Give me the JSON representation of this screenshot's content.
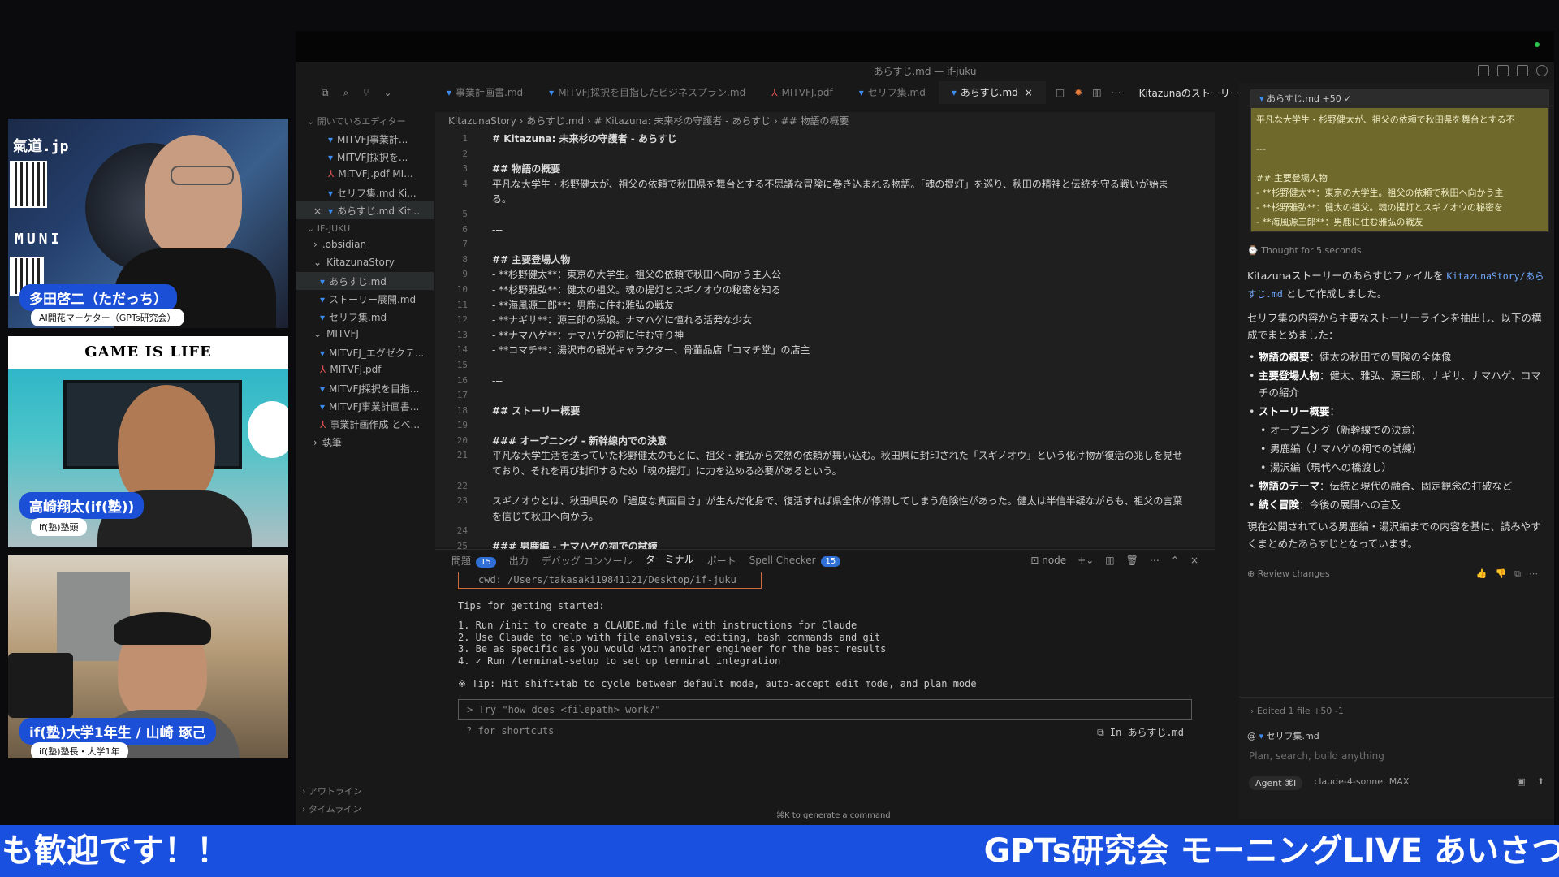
{
  "window": {
    "title": "あらすじ.md — if-juku"
  },
  "tabs": [
    {
      "label": "事業計画書.md",
      "kind": "md"
    },
    {
      "label": "MITVFJ採択を目指したビジネスプラン.md",
      "kind": "md"
    },
    {
      "label": "MITVFJ.pdf",
      "kind": "pdf"
    },
    {
      "label": "セリフ集.md",
      "kind": "md"
    },
    {
      "label": "あらすじ.md",
      "kind": "md",
      "active": true
    }
  ],
  "chat_tab": "Kitazunaのストーリーあらすじファイル作",
  "sidebar": {
    "open_editors_head": "開いているエディター",
    "open_editors": [
      {
        "label": "MITVFJ事業計...",
        "kind": "md"
      },
      {
        "label": "MITVFJ採択を...",
        "kind": "md"
      },
      {
        "label": "MITVFJ.pdf  MI...",
        "kind": "pdf"
      },
      {
        "label": "セリフ集.md  Ki...",
        "kind": "md"
      },
      {
        "label": "あらすじ.md  Kit...",
        "kind": "md",
        "close": "×"
      }
    ],
    "workspace_head": "IF-JUKU",
    "tree": [
      {
        "label": ".obsidian",
        "type": "folder",
        "arrow": "›"
      },
      {
        "label": "KitazunaStory",
        "type": "folder",
        "arrow": "⌄"
      },
      {
        "label": "あらすじ.md",
        "type": "file",
        "kind": "md",
        "selected": true
      },
      {
        "label": "ストーリー展開.md",
        "type": "file",
        "kind": "md"
      },
      {
        "label": "セリフ集.md",
        "type": "file",
        "kind": "md"
      },
      {
        "label": "MITVFJ",
        "type": "folder",
        "arrow": "⌄"
      },
      {
        "label": "MITVFJ_エグゼクテ...",
        "type": "file",
        "kind": "md"
      },
      {
        "label": "MITVFJ.pdf",
        "type": "file",
        "kind": "pdf"
      },
      {
        "label": "MITVFJ採択を目指...",
        "type": "file",
        "kind": "md"
      },
      {
        "label": "MITVFJ事業計画書...",
        "type": "file",
        "kind": "md"
      },
      {
        "label": "事業計画作成 とべ...",
        "type": "file",
        "kind": "pdf"
      },
      {
        "label": "執筆",
        "type": "folder",
        "arrow": "›"
      }
    ],
    "outline": "アウトライン",
    "timeline": "タイムライン"
  },
  "breadcrumb": "KitazunaStory  ›  あらすじ.md  ›  # Kitazuna: 未来杉の守護者 - あらすじ  ›  ## 物語の概要",
  "editor_lines": [
    {
      "n": "1",
      "text": "# Kitazuna: 未来杉の守護者 - あらすじ",
      "h": true
    },
    {
      "n": "2",
      "text": ""
    },
    {
      "n": "3",
      "text": "## 物語の概要",
      "h": true
    },
    {
      "n": "4",
      "text": "平凡な大学生・杉野健太が、祖父の依頼で秋田県を舞台とする不思議な冒険に巻き込まれる物語。「魂の提灯」を巡り、秋田の精神と伝統を守る戦いが始ま"
    },
    {
      "n": "",
      "text": "る。"
    },
    {
      "n": "5",
      "text": ""
    },
    {
      "n": "6",
      "text": "---"
    },
    {
      "n": "7",
      "text": ""
    },
    {
      "n": "8",
      "text": "## 主要登場人物",
      "h": true
    },
    {
      "n": "9",
      "text": "- **杉野健太**：東京の大学生。祖父の依頼で秋田へ向かう主人公"
    },
    {
      "n": "10",
      "text": "- **杉野雅弘**：健太の祖父。魂の提灯とスギノオウの秘密を知る"
    },
    {
      "n": "11",
      "text": "- **海風源三郎**：男鹿に住む雅弘の戦友"
    },
    {
      "n": "12",
      "text": "- **ナギサ**：源三郎の孫娘。ナマハゲに憧れる活発な少女"
    },
    {
      "n": "13",
      "text": "- **ナマハゲ**：ナマハゲの祠に住む守り神"
    },
    {
      "n": "14",
      "text": "- **コマチ**：湯沢市の観光キャラクター、骨董品店「コマチ堂」の店主"
    },
    {
      "n": "15",
      "text": ""
    },
    {
      "n": "16",
      "text": "---"
    },
    {
      "n": "17",
      "text": ""
    },
    {
      "n": "18",
      "text": "## ストーリー概要",
      "h": true
    },
    {
      "n": "19",
      "text": ""
    },
    {
      "n": "20",
      "text": "### オープニング - 新幹線内での決意",
      "h": true
    },
    {
      "n": "21",
      "text": "平凡な大学生活を送っていた杉野健太のもとに、祖父・雅弘から突然の依頼が舞い込む。秋田県に封印された「スギノオウ」という化け物が復活の兆しを見せ"
    },
    {
      "n": "",
      "text": "ており、それを再び封印するため「魂の提灯」に力を込める必要があるという。"
    },
    {
      "n": "22",
      "text": ""
    },
    {
      "n": "23",
      "text": "スギノオウとは、秋田県民の「過度な真面目さ」が生んだ化身で、復活すれば県全体が停滞してしまう危険性があった。健太は半信半疑ながらも、祖父の言葉"
    },
    {
      "n": "",
      "text": "を信じて秋田へ向かう。"
    },
    {
      "n": "24",
      "text": ""
    },
    {
      "n": "25",
      "text": "### 男鹿編 - ナマハゲの祠での試練",
      "h": true
    }
  ],
  "panel": {
    "tabs": [
      "問題",
      "出力",
      "デバッグ コンソール",
      "ターミナル",
      "ポート",
      "Spell Checker"
    ],
    "problems_count": "15",
    "spell_count": "15",
    "shell": "node",
    "cwd": "cwd: /Users/takasaki19841121/Desktop/if-juku",
    "tips_head": "Tips for getting started:",
    "tips": [
      "1. Run /init to create a CLAUDE.md file with instructions for Claude",
      "2. Use Claude to help with file analysis, editing, bash commands and git",
      "3. Be as specific as you would with another engineer for the best results",
      "4. ✓ Run /terminal-setup to set up terminal integration"
    ],
    "tip_shift": "※ Tip: Hit shift+tab to cycle between default mode, auto-accept edit mode, and plan mode",
    "prompt_placeholder": "> Try \"how does <filepath> work?\"",
    "shortcuts": "? for shortcuts",
    "in_file": "⧉ In あらすじ.md",
    "gen_cmd": "⌘K to generate a command"
  },
  "chat": {
    "preview_file": "あらすじ.md  +50 ✓",
    "preview_lines": [
      "平凡な大学生・杉野健太が、祖父の依頼で秋田県を舞台とする不",
      "",
      "---",
      "",
      "## 主要登場人物",
      "- **杉野健太**：東京の大学生。祖父の依頼で秋田へ向かう主",
      "- **杉野雅弘**：健太の祖父。魂の提灯とスギノオウの秘密を",
      "- **海風源三郎**：男鹿に住む雅弘の戦友"
    ],
    "thought": "Thought for 5 seconds",
    "intro_a": "Kitazunaストーリーのあらすじファイルを",
    "intro_code": "KitazunaStory/あらすじ.md",
    "intro_b": "として作成しました。",
    "para2": "セリフ集の内容から主要なストーリーラインを抽出し、以下の構成でまとめました：",
    "bullets": [
      {
        "k": "物語の概要",
        "v": "：健太の秋田での冒険の全体像"
      },
      {
        "k": "主要登場人物",
        "v": "：健太、雅弘、源三郎、ナギサ、ナマハゲ、コマチの紹介"
      },
      {
        "k": "ストーリー概要",
        "v": "："
      },
      {
        "k": "物語のテーマ",
        "v": "：伝統と現代の融合、固定観念の打破など"
      },
      {
        "k": "続く冒険",
        "v": "：今後の展開への言及"
      }
    ],
    "sub_bullets": [
      "オープニング（新幹線での決意）",
      "男鹿編（ナマハゲの祠での試練）",
      "湯沢編（現代への橋渡し）"
    ],
    "closing": "現在公開されている男鹿編・湯沢編までの内容を基に、読みやすくまとめたあらすじとなっています。",
    "review": "Review changes",
    "edited": "Edited 1 file +50 -1",
    "context_file": "セリフ集.md",
    "plan_placeholder": "Plan, search, build anything",
    "agent": "Agent ⌘I",
    "model": "claude-4-sonnet  MAX"
  },
  "webcams": [
    {
      "brand": "氣道.jp",
      "side_text": "MUNI",
      "name": "多田啓二（ただっち）",
      "sub": "AI開花マーケター（GPTs研究会）"
    },
    {
      "banner": "GAME IS LIFE",
      "name": "高崎翔太(if(塾))",
      "sub": "if(塾)塾頭"
    },
    {
      "name": "if(塾)大学1年生 / 山崎 琢己",
      "sub": "if(塾)塾長・大学1年"
    }
  ],
  "ticker": {
    "left": "も歓迎です！！",
    "right": "GPTs研究会 モーニングLIVE あいさつ"
  }
}
